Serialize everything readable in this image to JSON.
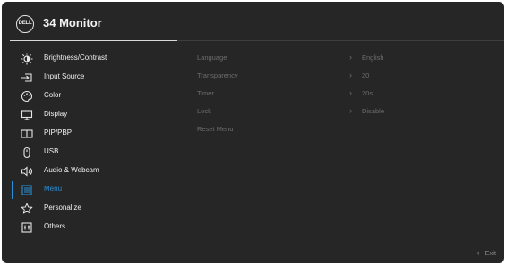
{
  "header": {
    "logo_text": "DELL",
    "title": "34 Monitor"
  },
  "sidebar": {
    "items": [
      {
        "label": "Brightness/Contrast",
        "icon": "brightness-icon"
      },
      {
        "label": "Input Source",
        "icon": "input-source-icon"
      },
      {
        "label": "Color",
        "icon": "color-palette-icon"
      },
      {
        "label": "Display",
        "icon": "display-icon"
      },
      {
        "label": "PIP/PBP",
        "icon": "pip-pbp-icon"
      },
      {
        "label": "USB",
        "icon": "usb-icon"
      },
      {
        "label": "Audio & Webcam",
        "icon": "audio-webcam-icon"
      },
      {
        "label": "Menu",
        "icon": "menu-icon",
        "active": true
      },
      {
        "label": "Personalize",
        "icon": "star-icon"
      },
      {
        "label": "Others",
        "icon": "others-icon"
      }
    ]
  },
  "settings": {
    "rows": [
      {
        "name": "Language",
        "value": "English"
      },
      {
        "name": "Transparency",
        "value": "20"
      },
      {
        "name": "Timer",
        "value": "20s"
      },
      {
        "name": "Lock",
        "value": "Disable"
      },
      {
        "name": "Reset Menu",
        "value": ""
      }
    ]
  },
  "footer": {
    "exit_label": "Exit"
  },
  "colors": {
    "background": "#262626",
    "accent": "#2a8fd6",
    "text": "#f0f0f0",
    "dim_text": "#6e6e6e"
  }
}
